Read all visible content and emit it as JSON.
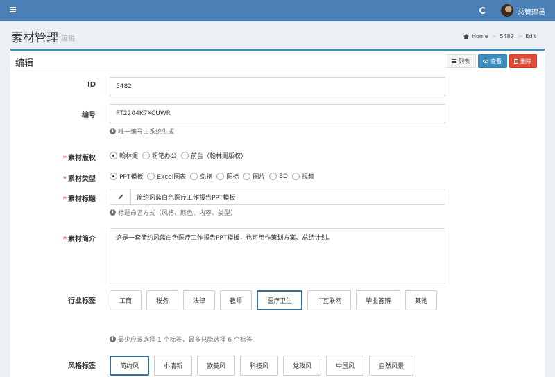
{
  "header": {
    "username": "总管理员"
  },
  "page": {
    "title": "素材管理",
    "subtitle": "编辑"
  },
  "breadcrumb": [
    "Home",
    "5482",
    "Edit"
  ],
  "box": {
    "title": "编辑",
    "buttons": {
      "list": "列表",
      "view": "查看",
      "delete": "删除"
    }
  },
  "form": {
    "id": {
      "label": "ID",
      "value": "5482"
    },
    "code": {
      "label": "编号",
      "value": "PT2204K7XCUWR",
      "help": "唯一编号由系统生成"
    },
    "copyright": {
      "label": "素材版权",
      "options": [
        "翰林阁",
        "粉笔办公",
        "前台（翰林阁版权）"
      ],
      "selected": 0
    },
    "type": {
      "label": "素材类型",
      "options": [
        "PPT模板",
        "Excel图表",
        "免抠",
        "图标",
        "图片",
        "3D",
        "视频"
      ],
      "selected": 0
    },
    "title": {
      "label": "素材标题",
      "value": "简约风蓝白色医疗工作报告PPT模板",
      "help": "标题命名方式（风格、颜色、内容、类型）"
    },
    "intro": {
      "label": "素材简介",
      "value": "这是一套简约风蓝白色医疗工作报告PPT模板，也可用作策划方案、总结计划。"
    },
    "industry": {
      "label": "行业标签",
      "tags": [
        "工商",
        "税务",
        "法律",
        "教师",
        "医疗卫生",
        "IT互联网",
        "毕业答辩",
        "其他"
      ],
      "selected": "医疗卫生",
      "help": "最少应该选择 1 个标签，最多只能选择 6 个标签"
    },
    "style": {
      "label": "风格标签",
      "tags": [
        "简约风",
        "小清新",
        "欧美风",
        "科技风",
        "党政风",
        "中国风",
        "自然风景"
      ],
      "selected": "简约风"
    }
  }
}
